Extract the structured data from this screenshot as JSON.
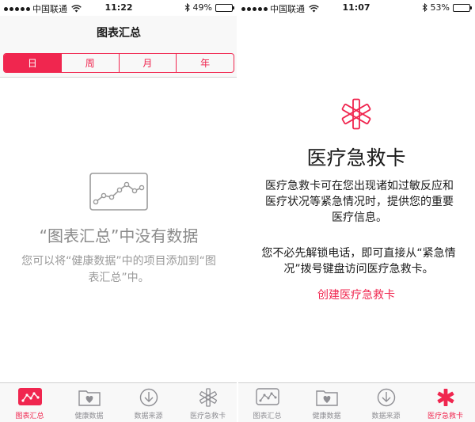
{
  "left": {
    "status": {
      "carrier": "中国联通",
      "time": "11:22",
      "battery": "49%",
      "battery_level": 0.49
    },
    "nav_title": "图表汇总",
    "segments": [
      {
        "label": "日",
        "active": true
      },
      {
        "label": "周",
        "active": false
      },
      {
        "label": "月",
        "active": false
      },
      {
        "label": "年",
        "active": false
      }
    ],
    "empty": {
      "title": "“图表汇总”中没有数据",
      "subtitle": "您可以将“健康数据”中的项目添加到“图表汇总”中。"
    },
    "tabs": [
      {
        "label": "图表汇总",
        "icon": "chart-icon",
        "active": true
      },
      {
        "label": "健康数据",
        "icon": "heart-folder-icon",
        "active": false
      },
      {
        "label": "数据来源",
        "icon": "download-icon",
        "active": false
      },
      {
        "label": "医疗急救卡",
        "icon": "medical-star-icon",
        "active": false
      }
    ]
  },
  "right": {
    "status": {
      "carrier": "中国联通",
      "time": "11:07",
      "battery": "53%",
      "battery_level": 0.53
    },
    "title": "医疗急救卡",
    "description": "医疗急救卡可在您出现诸如过敏反应和医疗状况等紧急情况时，提供您的重要医疗信息。",
    "description2": "您不必先解锁电话，即可直接从“紧急情况”拨号键盘访问医疗急救卡。",
    "create_link": "创建医疗急救卡",
    "tabs": [
      {
        "label": "图表汇总",
        "icon": "chart-icon",
        "active": false
      },
      {
        "label": "健康数据",
        "icon": "heart-folder-icon",
        "active": false
      },
      {
        "label": "数据来源",
        "icon": "download-icon",
        "active": false
      },
      {
        "label": "医疗急救卡",
        "icon": "medical-star-icon",
        "active": true
      }
    ]
  },
  "colors": {
    "accent": "#f0264f",
    "inactive": "#8e8e93"
  }
}
